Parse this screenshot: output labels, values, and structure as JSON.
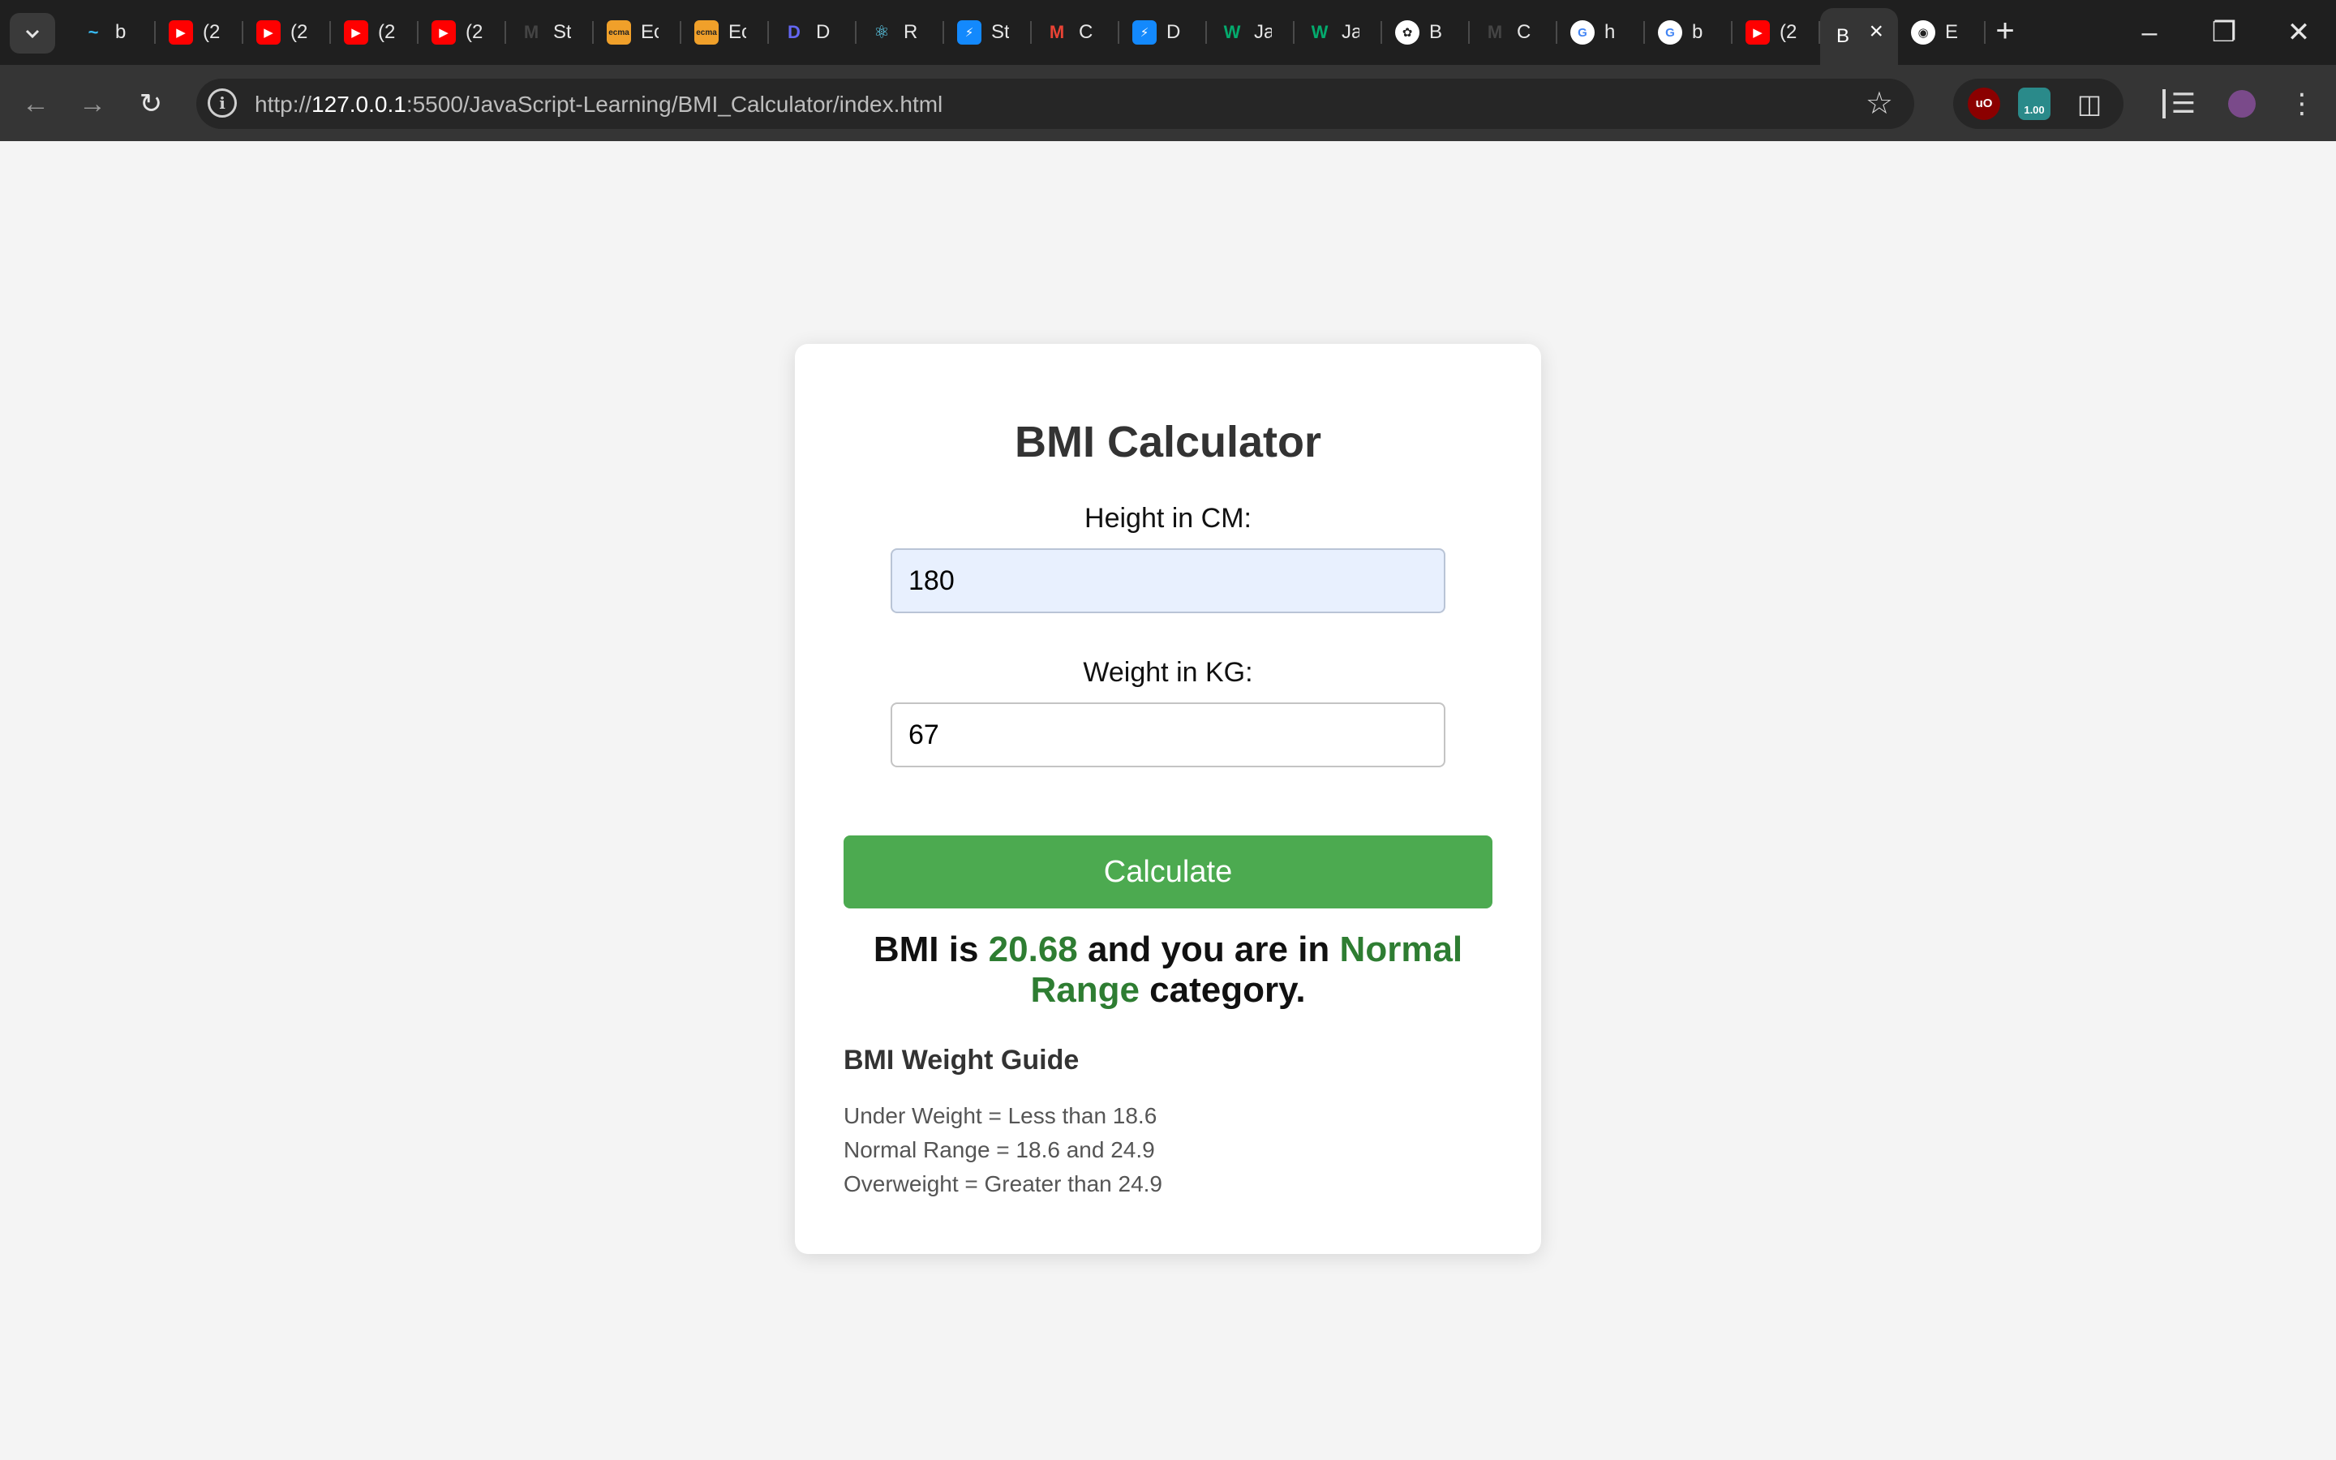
{
  "browser": {
    "tabs": [
      {
        "title": "b",
        "icon": "tailwind-icon",
        "color": "#38bdf8"
      },
      {
        "title": "(2",
        "icon": "youtube-icon",
        "color": "#ff0000"
      },
      {
        "title": "(2",
        "icon": "youtube-icon",
        "color": "#ff0000"
      },
      {
        "title": "(2",
        "icon": "youtube-icon",
        "color": "#ff0000"
      },
      {
        "title": "(2",
        "icon": "youtube-icon",
        "color": "#ff0000"
      },
      {
        "title": "St",
        "icon": "medium-icon",
        "color": "#444444"
      },
      {
        "title": "Ec",
        "icon": "ecma-icon",
        "color": "#f0a02a"
      },
      {
        "title": "Ec",
        "icon": "ecma-icon",
        "color": "#f0a02a"
      },
      {
        "title": "D",
        "icon": "deno-icon",
        "color": "#6366f1"
      },
      {
        "title": "R",
        "icon": "react-icon",
        "color": "#61dafb"
      },
      {
        "title": "St",
        "icon": "stackblitz-icon",
        "color": "#1389fd"
      },
      {
        "title": "C",
        "icon": "gmail-icon",
        "color": "#ea4335"
      },
      {
        "title": "D",
        "icon": "stackblitz-icon",
        "color": "#1389fd"
      },
      {
        "title": "Ja",
        "icon": "w3schools-icon",
        "color": "#04aa6d"
      },
      {
        "title": "Ja",
        "icon": "w3schools-icon",
        "color": "#04aa6d"
      },
      {
        "title": "B",
        "icon": "chatgpt-icon",
        "color": "#ffffff"
      },
      {
        "title": "C",
        "icon": "medium-icon",
        "color": "#444444"
      },
      {
        "title": "h",
        "icon": "google-icon",
        "color": "#ffffff"
      },
      {
        "title": "b",
        "icon": "google-icon",
        "color": "#ffffff"
      },
      {
        "title": "(2",
        "icon": "youtube-icon",
        "color": "#ff0000"
      },
      {
        "title": "B",
        "icon": "page-icon",
        "color": "#353535",
        "active": true
      },
      {
        "title": "E",
        "icon": "github-icon",
        "color": "#ffffff"
      }
    ],
    "url_host": "127.0.0.1",
    "url_path": ":5500/JavaScript-Learning/BMI_Calculator/index.html",
    "url_scheme": "http://",
    "extension_badge": "1.00"
  },
  "page": {
    "title": "BMI Calculator",
    "height_label": "Height in CM:",
    "height_value": "180",
    "weight_label": "Weight in KG:",
    "weight_value": "67",
    "calculate_label": "Calculate",
    "result": {
      "prefix": "BMI is",
      "bmi": "20.68",
      "middle": "and you are in",
      "category": "Normal Range",
      "suffix": "category."
    },
    "guide": {
      "title": "BMI Weight Guide",
      "items": [
        "Under Weight = Less than 18.6",
        "Normal Range = 18.6 and 24.9",
        "Overweight = Greater than 24.9"
      ]
    }
  },
  "colors": {
    "accent_green": "#4caa50",
    "result_highlight": "#2e7d32",
    "page_background": "#f4f4f4"
  }
}
